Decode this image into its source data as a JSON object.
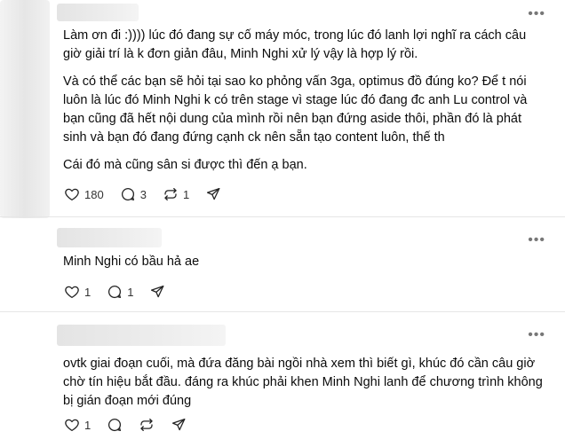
{
  "comments": [
    {
      "paragraphs": [
        "Làm ơn đi :)))) lúc đó đang sự cố máy móc, trong lúc đó lanh lợi nghĩ ra cách câu giờ giải trí là k đơn giản đâu, Minh Nghi xử lý vậy là hợp lý rồi.",
        "Và có thể các bạn sẽ hỏi tại sao ko phỏng vấn 3ga, optimus đồ đúng ko? Để t nói luôn là lúc đó Minh Nghi k có trên stage vì stage lúc đó đang đc anh Lu control và bạn cũng đã hết nội dung của mình rồi nên bạn đứng aside thôi, phần đó là phát sinh và bạn đó đang đứng cạnh ck nên sẵn tạo content luôn, thế th",
        "Cái đó mà cũng sân si được thì đến ạ bạn."
      ],
      "likes": "180",
      "replies": "3",
      "reposts": "1"
    },
    {
      "paragraphs": [
        "Minh Nghi có bầu hả ae"
      ],
      "likes": "1",
      "replies": "1",
      "reposts": ""
    },
    {
      "paragraphs": [
        "ovtk giai đoạn cuối, mà đứa đăng bài ngồi nhà xem thì biết gì, khúc đó cần câu giờ chờ tín hiệu bắt đầu. đáng ra khúc phải khen Minh Nghi lanh để chương trình không bị gián đoạn mới đúng"
      ],
      "likes": "1",
      "replies": "",
      "reposts": ""
    }
  ],
  "icons": {
    "more": "more-horizontal-icon",
    "like": "heart-icon",
    "reply": "comment-bubble-icon",
    "repost": "repost-arrows-icon",
    "share": "send-paper-plane-icon"
  }
}
